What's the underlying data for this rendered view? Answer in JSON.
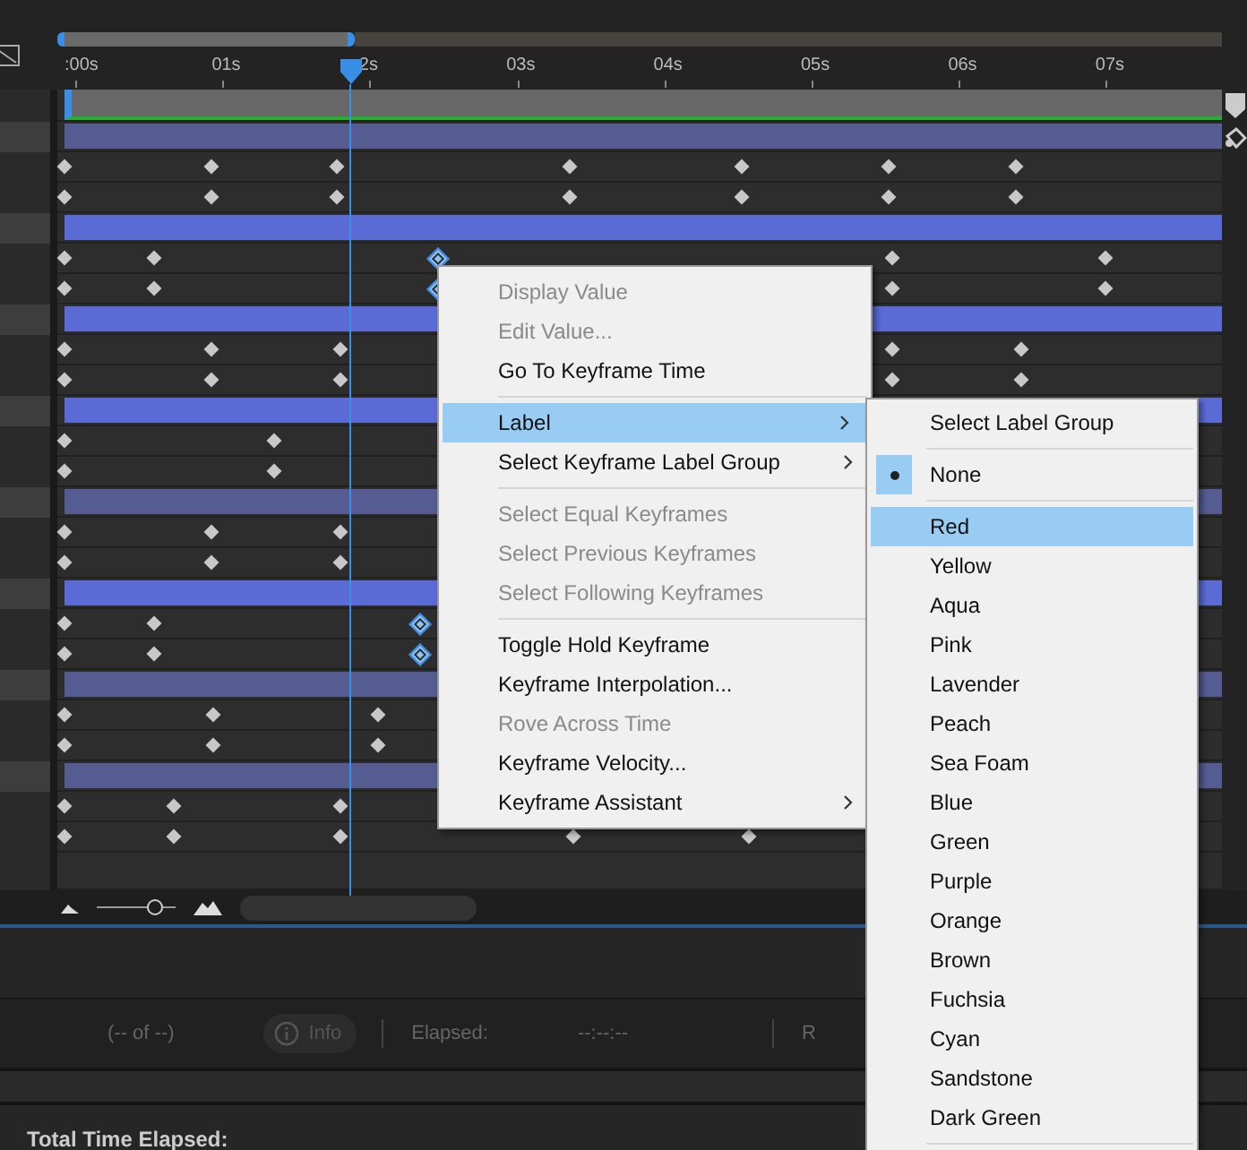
{
  "ruler": {
    "labels": [
      ":00s",
      "01s",
      "2s",
      "03s",
      "04s",
      "05s",
      "06s",
      "07s"
    ]
  },
  "playhead": {
    "level": 0.252
  },
  "tracks": [
    {
      "kind": "bar",
      "bright": false
    },
    {
      "kind": "keyframes",
      "keyframes": [
        {
          "selected": false
        },
        {
          "selected": false
        },
        {
          "selected": false
        },
        {
          "selected": false
        },
        {
          "selected": false
        },
        {
          "selected": false
        },
        {
          "selected": false
        }
      ]
    },
    {
      "kind": "keyframes",
      "keyframes": [
        {
          "selected": false
        },
        {
          "selected": false
        },
        {
          "selected": false
        },
        {
          "selected": false
        },
        {
          "selected": false
        },
        {
          "selected": false
        },
        {
          "selected": false
        }
      ]
    },
    {
      "kind": "bar",
      "bright": true
    },
    {
      "kind": "keyframes",
      "keyframes": [
        {
          "selected": false
        },
        {
          "selected": false
        },
        {
          "selected": true
        },
        {
          "selected": false
        },
        {
          "selected": false
        }
      ]
    },
    {
      "kind": "keyframes",
      "keyframes": [
        {
          "selected": false
        },
        {
          "selected": false
        },
        {
          "selected": true
        },
        {
          "selected": false
        },
        {
          "selected": false
        }
      ]
    },
    {
      "kind": "bar",
      "bright": true
    },
    {
      "kind": "keyframes",
      "keyframes": [
        {
          "selected": false
        },
        {
          "selected": false
        },
        {
          "selected": false
        },
        {
          "selected": false
        },
        {
          "selected": false
        }
      ]
    },
    {
      "kind": "keyframes",
      "keyframes": [
        {
          "selected": false
        },
        {
          "selected": false
        },
        {
          "selected": false
        },
        {
          "selected": false
        },
        {
          "selected": false
        }
      ]
    },
    {
      "kind": "bar",
      "bright": true
    },
    {
      "kind": "keyframes",
      "keyframes": [
        {
          "selected": false
        },
        {
          "selected": false
        }
      ]
    },
    {
      "kind": "keyframes",
      "keyframes": [
        {
          "selected": false
        },
        {
          "selected": false
        }
      ]
    },
    {
      "kind": "bar",
      "bright": false
    },
    {
      "kind": "keyframes",
      "keyframes": [
        {
          "selected": false
        },
        {
          "selected": false
        },
        {
          "selected": false
        }
      ]
    },
    {
      "kind": "keyframes",
      "keyframes": [
        {
          "selected": false
        },
        {
          "selected": false
        },
        {
          "selected": false
        }
      ]
    },
    {
      "kind": "bar",
      "bright": true
    },
    {
      "kind": "keyframes",
      "keyframes": [
        {
          "selected": false
        },
        {
          "selected": false
        },
        {
          "selected": true
        }
      ]
    },
    {
      "kind": "keyframes",
      "keyframes": [
        {
          "selected": false
        },
        {
          "selected": false
        },
        {
          "selected": true
        }
      ]
    },
    {
      "kind": "bar",
      "bright": false
    },
    {
      "kind": "keyframes",
      "keyframes": [
        {
          "selected": false
        },
        {
          "selected": false
        },
        {
          "selected": false
        }
      ]
    },
    {
      "kind": "keyframes",
      "keyframes": [
        {
          "selected": false
        },
        {
          "selected": false
        },
        {
          "selected": false
        }
      ]
    },
    {
      "kind": "bar",
      "bright": false
    },
    {
      "kind": "keyframes",
      "keyframes": [
        {
          "selected": false
        },
        {
          "selected": false
        },
        {
          "selected": false
        }
      ]
    },
    {
      "kind": "keyframes",
      "keyframes": [
        {
          "selected": false
        },
        {
          "selected": false
        },
        {
          "selected": false
        },
        {
          "selected": false
        },
        {
          "selected": false
        }
      ]
    }
  ],
  "zoom_slider": {
    "level": 0.72
  },
  "status": {
    "count": "(-- of --)",
    "info_button": {
      "label": "Info",
      "disabled": true
    },
    "elapsed_label": "Elapsed:",
    "elapsed_value": "--:--:--",
    "cut_label": "R"
  },
  "footer": {
    "total_label": "Total Time Elapsed:"
  },
  "context_menu": {
    "items": [
      {
        "kind": "item",
        "label": "Display Value",
        "disabled": true,
        "highlighted": false,
        "submenu": false
      },
      {
        "kind": "item",
        "label": "Edit Value...",
        "disabled": true,
        "highlighted": false,
        "submenu": false
      },
      {
        "kind": "item",
        "label": "Go To Keyframe Time",
        "disabled": false,
        "highlighted": false,
        "submenu": false
      },
      {
        "kind": "separator"
      },
      {
        "kind": "item",
        "label": "Label",
        "disabled": false,
        "highlighted": true,
        "submenu": true
      },
      {
        "kind": "item",
        "label": "Select Keyframe Label Group",
        "disabled": false,
        "highlighted": false,
        "submenu": true
      },
      {
        "kind": "separator"
      },
      {
        "kind": "item",
        "label": "Select Equal Keyframes",
        "disabled": true,
        "highlighted": false,
        "submenu": false
      },
      {
        "kind": "item",
        "label": "Select Previous Keyframes",
        "disabled": true,
        "highlighted": false,
        "submenu": false
      },
      {
        "kind": "item",
        "label": "Select Following Keyframes",
        "disabled": true,
        "highlighted": false,
        "submenu": false
      },
      {
        "kind": "separator"
      },
      {
        "kind": "item",
        "label": "Toggle Hold Keyframe",
        "disabled": false,
        "highlighted": false,
        "submenu": false
      },
      {
        "kind": "item",
        "label": "Keyframe Interpolation...",
        "disabled": false,
        "highlighted": false,
        "submenu": false
      },
      {
        "kind": "item",
        "label": "Rove Across Time",
        "disabled": true,
        "highlighted": false,
        "submenu": false
      },
      {
        "kind": "item",
        "label": "Keyframe Velocity...",
        "disabled": false,
        "highlighted": false,
        "submenu": false
      },
      {
        "kind": "item",
        "label": "Keyframe Assistant",
        "disabled": false,
        "highlighted": false,
        "submenu": true
      }
    ]
  },
  "submenu": {
    "items": [
      {
        "kind": "item",
        "label": "Select Label Group",
        "checked": false,
        "highlighted": false
      },
      {
        "kind": "separator"
      },
      {
        "kind": "item",
        "label": "None",
        "checked": true,
        "highlighted": false
      },
      {
        "kind": "separator"
      },
      {
        "kind": "item",
        "label": "Red",
        "checked": false,
        "highlighted": true
      },
      {
        "kind": "item",
        "label": "Yellow",
        "checked": false,
        "highlighted": false
      },
      {
        "kind": "item",
        "label": "Aqua",
        "checked": false,
        "highlighted": false
      },
      {
        "kind": "item",
        "label": "Pink",
        "checked": false,
        "highlighted": false
      },
      {
        "kind": "item",
        "label": "Lavender",
        "checked": false,
        "highlighted": false
      },
      {
        "kind": "item",
        "label": "Peach",
        "checked": false,
        "highlighted": false
      },
      {
        "kind": "item",
        "label": "Sea Foam",
        "checked": false,
        "highlighted": false
      },
      {
        "kind": "item",
        "label": "Blue",
        "checked": false,
        "highlighted": false
      },
      {
        "kind": "item",
        "label": "Green",
        "checked": false,
        "highlighted": false
      },
      {
        "kind": "item",
        "label": "Purple",
        "checked": false,
        "highlighted": false
      },
      {
        "kind": "item",
        "label": "Orange",
        "checked": false,
        "highlighted": false
      },
      {
        "kind": "item",
        "label": "Brown",
        "checked": false,
        "highlighted": false
      },
      {
        "kind": "item",
        "label": "Fuchsia",
        "checked": false,
        "highlighted": false
      },
      {
        "kind": "item",
        "label": "Cyan",
        "checked": false,
        "highlighted": false
      },
      {
        "kind": "item",
        "label": "Sandstone",
        "checked": false,
        "highlighted": false
      },
      {
        "kind": "item",
        "label": "Dark Green",
        "checked": false,
        "highlighted": false
      },
      {
        "kind": "separator"
      }
    ]
  }
}
